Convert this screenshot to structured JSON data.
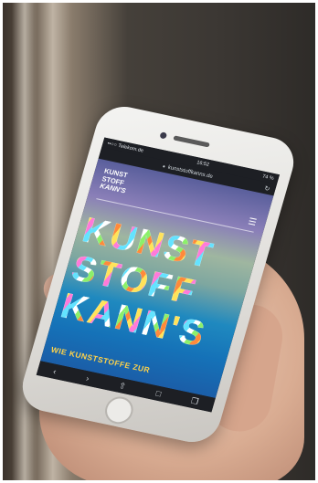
{
  "status": {
    "carrier": "••○○ Telekom.de",
    "time": "16:52",
    "battery": "74 %"
  },
  "browser": {
    "url": "kunststoffkanns.de"
  },
  "site": {
    "logo": [
      "KUNST",
      "STOFF",
      "KANN'S"
    ],
    "headline": [
      "KUNST",
      "STOFF",
      "KANN'S"
    ],
    "tagline": "WIE KUNSTSTOFFE ZUR"
  },
  "icons": {
    "menu": "hamburger-icon",
    "back": "chevron-left-icon",
    "forward": "chevron-right-icon",
    "share": "share-icon",
    "bookmarks": "book-icon",
    "tabs": "tabs-icon"
  }
}
